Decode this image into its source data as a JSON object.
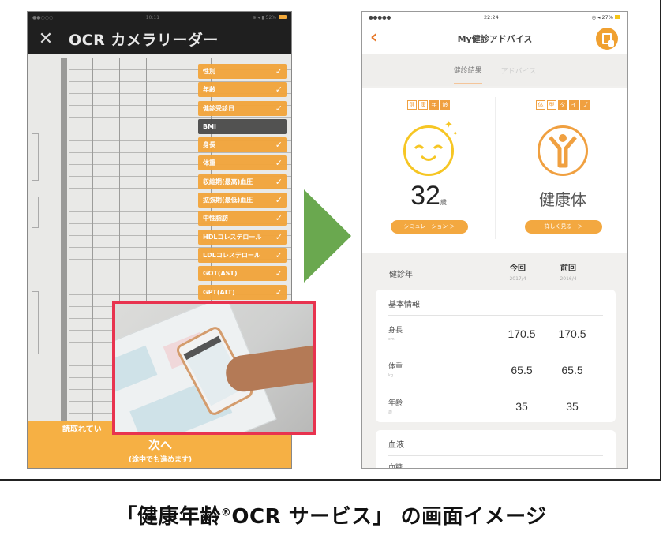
{
  "left_screen": {
    "status": {
      "carrier": "●●○○○",
      "time": "10:11",
      "icons": "⊕ ◂ ▮ 52%"
    },
    "title": "OCR カメラリーダー",
    "close_icon": "✕",
    "checklist": [
      {
        "label": "性別",
        "state": "checked"
      },
      {
        "label": "年齢",
        "state": "checked"
      },
      {
        "label": "健診受診日",
        "state": "checked"
      },
      {
        "label": "BMI",
        "state": "unread"
      },
      {
        "label": "身長",
        "state": "checked"
      },
      {
        "label": "体重",
        "state": "checked"
      },
      {
        "label": "収縮期(最高)血圧",
        "state": "checked"
      },
      {
        "label": "拡張期(最低)血圧",
        "state": "checked"
      },
      {
        "label": "中性脂肪",
        "state": "checked"
      },
      {
        "label": "HDLコレステロール",
        "state": "checked"
      },
      {
        "label": "LDLコレステロール",
        "state": "checked"
      },
      {
        "label": "GOT(AST)",
        "state": "checked"
      },
      {
        "label": "GPT(ALT)",
        "state": "checked"
      }
    ],
    "check_glyph": "✓",
    "bottom": {
      "message": "読取れてい",
      "next_label": "次へ",
      "next_sub": "(途中でも進めます)"
    }
  },
  "arrow_icon": "play-right",
  "right_screen": {
    "status": {
      "carrier": "●●●●●",
      "time": "22:24",
      "icons": "◎ ◂ 27%"
    },
    "back_icon": "‹",
    "title": "My健診アドバイス",
    "tabs": [
      {
        "label": "健診結果",
        "active": true
      },
      {
        "label": "アドバイス",
        "active": false
      }
    ],
    "summary": {
      "left": {
        "badges": [
          "健",
          "康",
          "年",
          "齢"
        ],
        "value": "32",
        "unit": "歳",
        "button": "シミュレーション ＞"
      },
      "right": {
        "badges": [
          "体",
          "型",
          "タ",
          "イ",
          "プ"
        ],
        "type": "健康体",
        "button": "詳しく見る　＞"
      }
    },
    "table_header": {
      "label": "健診年",
      "columns": [
        {
          "title": "今回",
          "date": "2017/4"
        },
        {
          "title": "前回",
          "date": "2016/4"
        }
      ]
    },
    "sections": [
      {
        "title": "基本情報",
        "rows": [
          {
            "label": "身長",
            "unit": "cm",
            "current": "170.5",
            "previous": "170.5"
          },
          {
            "label": "体重",
            "unit": "kg",
            "current": "65.5",
            "previous": "65.5"
          },
          {
            "label": "年齢",
            "unit": "歳",
            "current": "35",
            "previous": "35"
          }
        ]
      },
      {
        "title": "血液",
        "rows": [
          {
            "label": "血糖",
            "unit": "",
            "current": "",
            "previous": ""
          }
        ]
      }
    ]
  },
  "caption": {
    "pre": "「健康年齢",
    "reg": "®",
    "post": "OCR サービス」 の画面イメージ"
  },
  "colors": {
    "accent_orange": "#f2a43a",
    "arrow_green": "#6aa84f",
    "photo_border": "#e8334f",
    "smiley_yellow": "#f6c624"
  }
}
